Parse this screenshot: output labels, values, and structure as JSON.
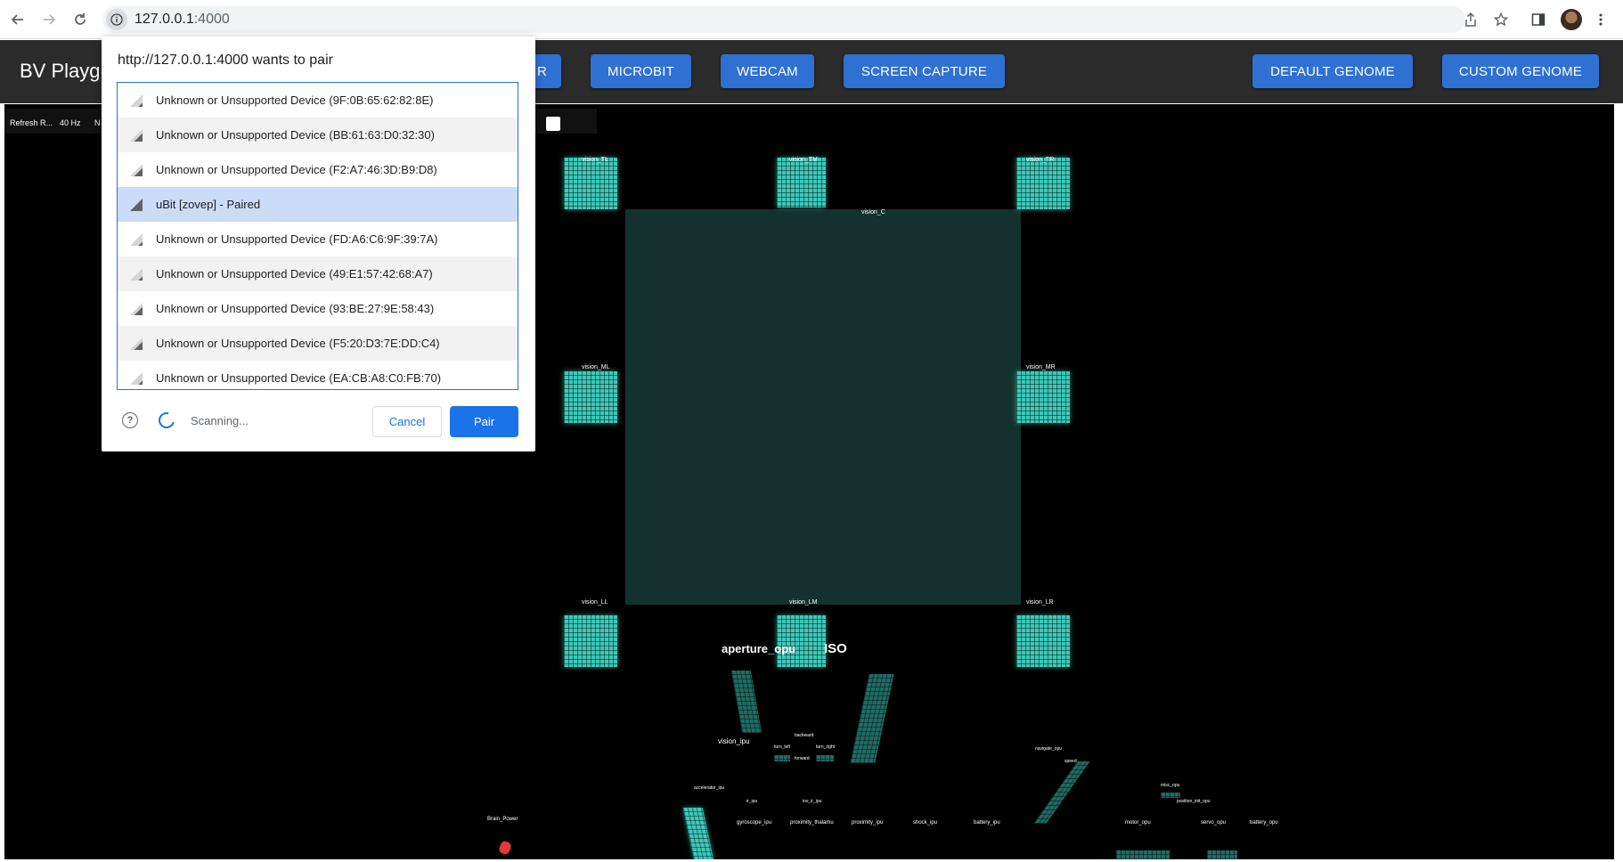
{
  "browser": {
    "url_host": "127.0.0.1",
    "url_port": ":4000",
    "icons": [
      "back-arrow-icon",
      "forward-arrow-icon",
      "reload-icon",
      "info-icon",
      "share-icon",
      "star-icon",
      "sidebar-icon",
      "menu-icon"
    ]
  },
  "app": {
    "title": "BV Playg",
    "buttons": {
      "partial": "R",
      "microbit": "MICROBIT",
      "webcam": "WEBCAM",
      "screen_capture": "SCREEN CAPTURE",
      "default_genome": "DEFAULT GENOME",
      "custom_genome": "CUSTOM GENOME"
    },
    "accent_color": "#2f70d3"
  },
  "toolbar": {
    "refresh_label": "Refresh R...",
    "rate": "40 Hz",
    "partial": "N"
  },
  "brain_view": {
    "vision_labels": {
      "tl": "vision_TL",
      "tm": "vision_TM",
      "tr": "vision_TR",
      "c": "vision_C",
      "ml": "vision_ML",
      "mr": "vision_MR",
      "ll": "vision_LL",
      "lm": "vision_LM",
      "lr": "vision_LR"
    },
    "aperture_label": "aperture_opu",
    "iso_label": "ISO",
    "small_labels": {
      "vision_ipu": "vision_ipu",
      "backward": "backward",
      "turn_left": "turn_left",
      "turn_right": "turn_right",
      "forward": "forward",
      "navigate_opu": "navigate_opu",
      "speed": "speed",
      "accelerator_ipu": "accelerator_ipu",
      "ir_ipu": "ir_ipu",
      "inv_ir_ipu": "inv_ir_ipu",
      "misc_opu": "misc_opu",
      "position_init_opu": "position_init_opu",
      "brain_power": "Brain_Power",
      "gyroscope_ipu": "gyroscope_ipu",
      "proximity_thalamus": "proximity_thalamu",
      "proximity_ipu": "proximity_ipu",
      "shock_ipu": "shock_ipu",
      "battery_ipu": "battery_ipu",
      "motor_opu": "motor_opu",
      "servo_opu": "servo_opu",
      "battery_opu": "battery_opu"
    },
    "node_color": "#3cc9b9",
    "power_color": "#e53935"
  },
  "dialog": {
    "title": "http://127.0.0.1:4000 wants to pair",
    "devices": [
      {
        "label": "Unknown or Unsupported Device (9F:0B:65:62:82:8E)",
        "signal": 1
      },
      {
        "label": "Unknown or Unsupported Device (BB:61:63:D0:32:30)",
        "signal": 2
      },
      {
        "label": "Unknown or Unsupported Device (F2:A7:46:3D:B9:D8)",
        "signal": 2
      },
      {
        "label": "uBit [zovep] - Paired",
        "signal": 3
      },
      {
        "label": "Unknown or Unsupported Device (FD:A6:C6:9F:39:7A)",
        "signal": 1
      },
      {
        "label": "Unknown or Unsupported Device (49:E1:57:42:68:A7)",
        "signal": 1
      },
      {
        "label": "Unknown or Unsupported Device (93:BE:27:9E:58:43)",
        "signal": 2
      },
      {
        "label": "Unknown or Unsupported Device (F5:20:D3:7E:DD:C4)",
        "signal": 2
      },
      {
        "label": "Unknown or Unsupported Device (EA:CB:A8:C0:FB:70)",
        "signal": 1
      }
    ],
    "selected_index": 3,
    "status": "Scanning...",
    "cancel_label": "Cancel",
    "pair_label": "Pair",
    "help_icon": "?"
  }
}
